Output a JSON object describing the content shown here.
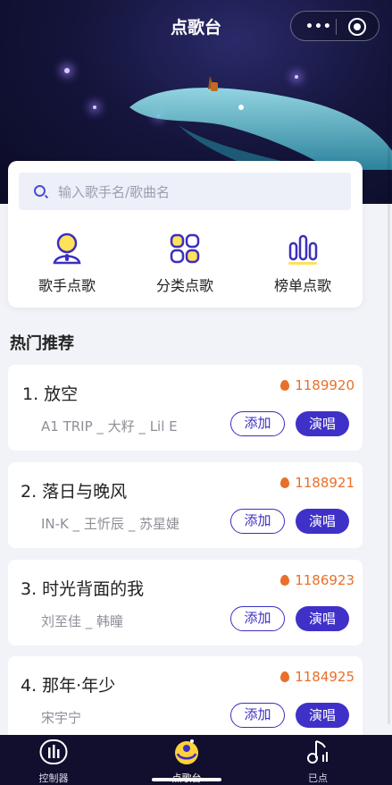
{
  "header": {
    "title": "点歌台",
    "more_icon": "ellipsis-icon",
    "close_icon": "target-icon"
  },
  "search": {
    "placeholder": "输入歌手名/歌曲名"
  },
  "categories": [
    {
      "label": "歌手点歌",
      "icon": "singer-icon"
    },
    {
      "label": "分类点歌",
      "icon": "grid-icon"
    },
    {
      "label": "榜单点歌",
      "icon": "chart-icon"
    }
  ],
  "section": {
    "title": "热门推荐"
  },
  "songs": [
    {
      "name": "1. 放空",
      "artist": "A1 TRIP _ 大籽 _ Lil E",
      "heat": "1189920",
      "add": "添加",
      "sing": "演唱"
    },
    {
      "name": "2. 落日与晚风",
      "artist": "IN-K _ 王忻辰 _ 苏星婕",
      "heat": "1188921",
      "add": "添加",
      "sing": "演唱"
    },
    {
      "name": "3. 时光背面的我",
      "artist": "刘至佳 _ 韩瞳",
      "heat": "1186923",
      "add": "添加",
      "sing": "演唱"
    },
    {
      "name": "4. 那年·年少",
      "artist": "宋宇宁",
      "heat": "1184925",
      "add": "添加",
      "sing": "演唱"
    }
  ],
  "tabbar": [
    {
      "label": "控制器",
      "icon": "controller-icon"
    },
    {
      "label": "点歌台",
      "icon": "song-station-icon",
      "active": true
    },
    {
      "label": "已点",
      "icon": "music-note-icon"
    }
  ],
  "colors": {
    "accent": "#3f31c8",
    "heat": "#e8702a",
    "tabbar": "#120e2e"
  }
}
